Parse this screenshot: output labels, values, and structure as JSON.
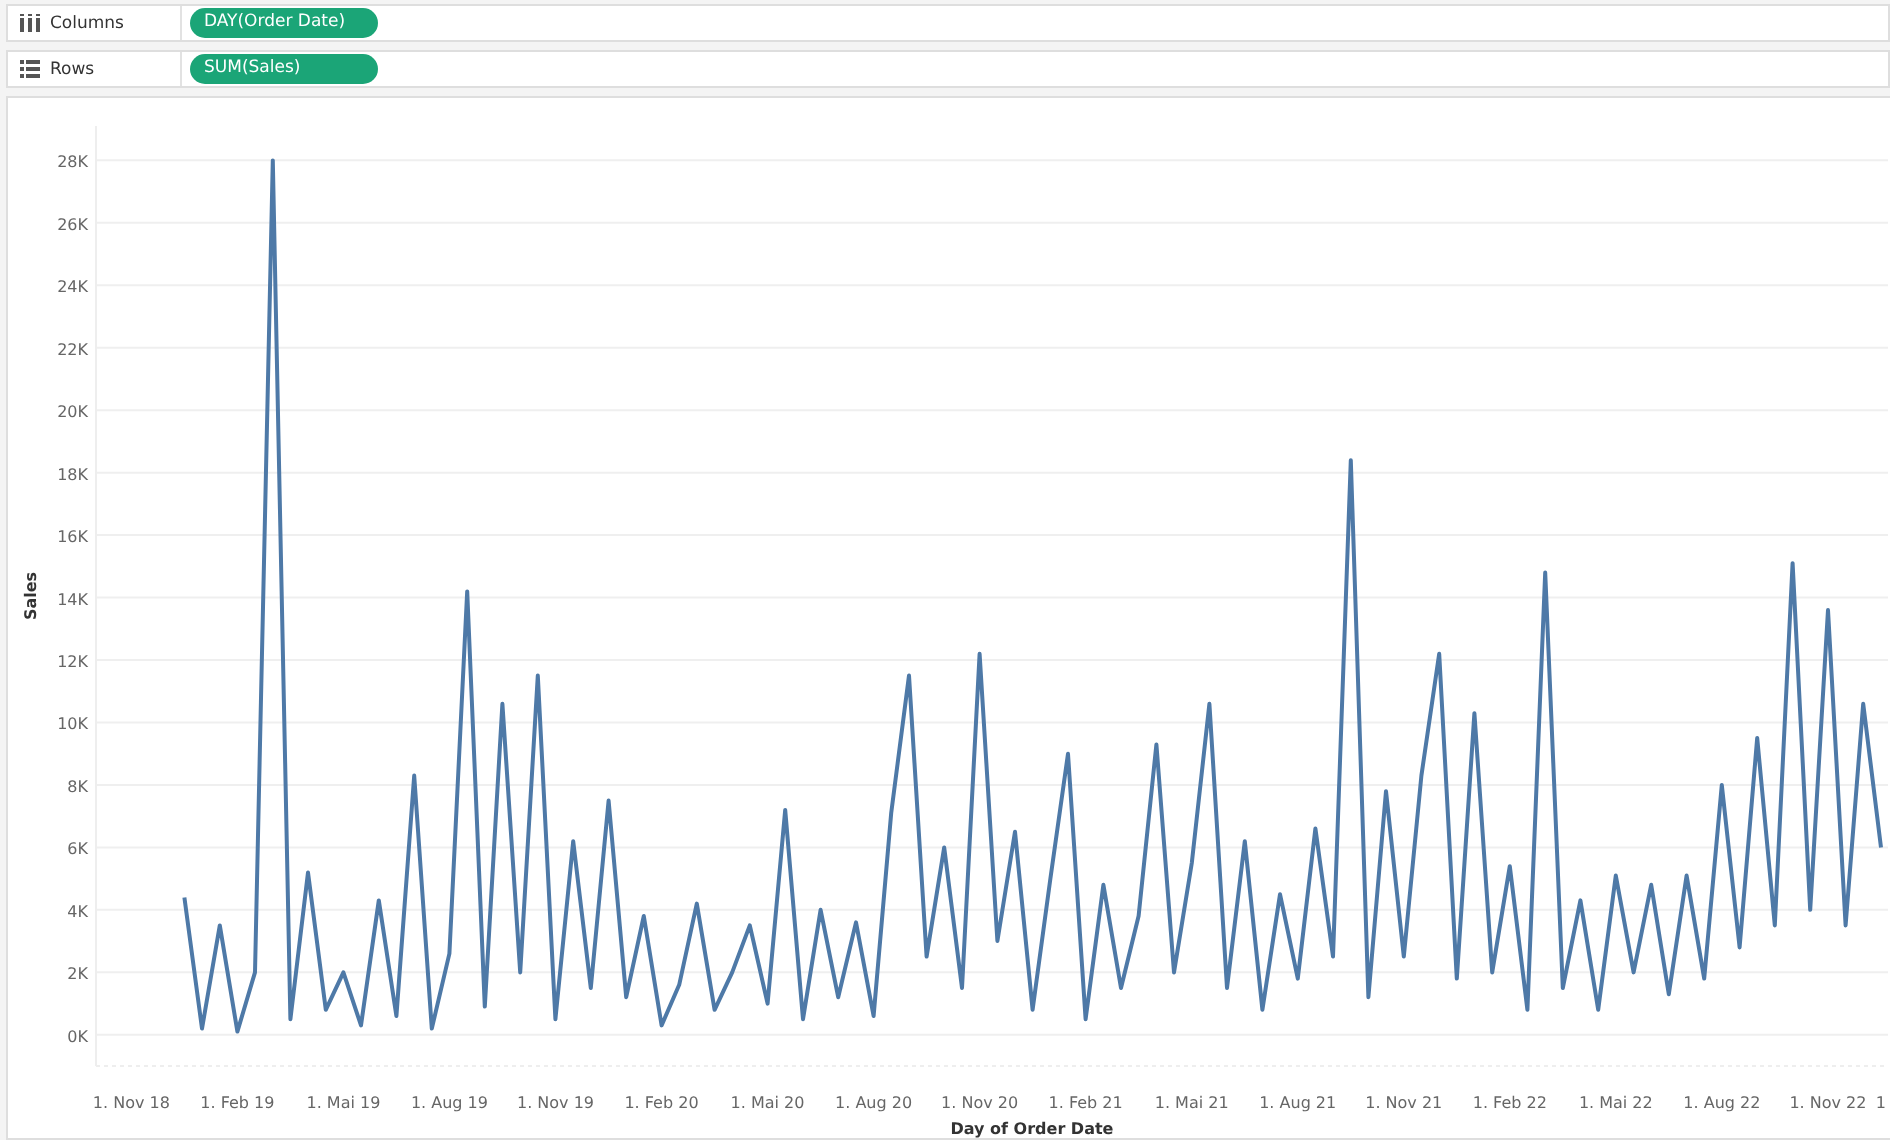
{
  "shelves": [
    {
      "kind": "columns",
      "label": "Columns",
      "pill": "DAY(Order Date)"
    },
    {
      "kind": "rows",
      "label": "Rows",
      "pill": "SUM(Sales)"
    }
  ],
  "chart": {
    "chart_data": {
      "type": "line",
      "xlabel": "Day of Order Date",
      "ylabel": "Sales",
      "categories": [
        "1. Nov 18",
        null,
        null,
        null,
        null,
        null,
        "1. Feb 19",
        null,
        null,
        null,
        null,
        null,
        "1. Mai 19",
        null,
        null,
        null,
        null,
        null,
        "1. Aug 19",
        null,
        null,
        null,
        null,
        null,
        "1. Nov 19",
        null,
        null,
        null,
        null,
        null,
        "1. Feb 20",
        null,
        null,
        null,
        null,
        null,
        "1. Mai 20",
        null,
        null,
        null,
        null,
        null,
        "1. Aug 20",
        null,
        null,
        null,
        null,
        null,
        "1. Nov 20",
        null,
        null,
        null,
        null,
        null,
        "1. Feb 21",
        null,
        null,
        null,
        null,
        null,
        "1. Mai 21",
        null,
        null,
        null,
        null,
        null,
        "1. Aug 21",
        null,
        null,
        null,
        null,
        null,
        "1. Nov 21",
        null,
        null,
        null,
        null,
        null,
        "1. Feb 22",
        null,
        null,
        null,
        null,
        null,
        "1. Mai 22",
        null,
        null,
        null,
        null,
        null,
        "1. Aug 22",
        null,
        null,
        null,
        null,
        null,
        "1. Nov 22",
        null,
        null,
        null
      ],
      "series": [
        {
          "color": "#4e79a7",
          "values": [
            null,
            null,
            null,
            4400,
            200,
            3500,
            100,
            2000,
            28000,
            500,
            5200,
            800,
            2000,
            300,
            4300,
            600,
            8300,
            200,
            2600,
            14200,
            900,
            10600,
            2000,
            11500,
            500,
            6200,
            1500,
            7500,
            1200,
            3800,
            300,
            1600,
            4200,
            800,
            2000,
            3500,
            1000,
            7200,
            500,
            4000,
            1200,
            3600,
            600,
            7100,
            11500,
            2500,
            6000,
            1500,
            12200,
            3000,
            6500,
            800,
            5000,
            9000,
            500,
            4800,
            1500,
            3800,
            9300,
            2000,
            5500,
            10600,
            1500,
            6200,
            800,
            4500,
            1800,
            6600,
            2500,
            18400,
            1200,
            7800,
            2500,
            8300,
            12200,
            1800,
            10300,
            2000,
            5400,
            800,
            14800,
            1500,
            4300,
            800,
            5100,
            2000,
            4800,
            1300,
            5100,
            1800,
            8000,
            2800,
            9500,
            3500,
            15100,
            4000,
            13600,
            3500,
            10600,
            6000
          ]
        }
      ],
      "ylim": [
        -1000,
        29100
      ],
      "grid": true,
      "yticks": [
        {
          "value": 0,
          "label": "0K"
        },
        {
          "value": 2000,
          "label": "2K"
        },
        {
          "value": 4000,
          "label": "4K"
        },
        {
          "value": 6000,
          "label": "6K"
        },
        {
          "value": 8000,
          "label": "8K"
        },
        {
          "value": 10000,
          "label": "10K"
        },
        {
          "value": 12000,
          "label": "12K"
        },
        {
          "value": 14000,
          "label": "14K"
        },
        {
          "value": 16000,
          "label": "16K"
        },
        {
          "value": 18000,
          "label": "18K"
        },
        {
          "value": 20000,
          "label": "20K"
        },
        {
          "value": 22000,
          "label": "22K"
        },
        {
          "value": 24000,
          "label": "24K"
        },
        {
          "value": 26000,
          "label": "26K"
        },
        {
          "value": 28000,
          "label": "28K"
        }
      ]
    },
    "cut_axis_label": "1"
  }
}
